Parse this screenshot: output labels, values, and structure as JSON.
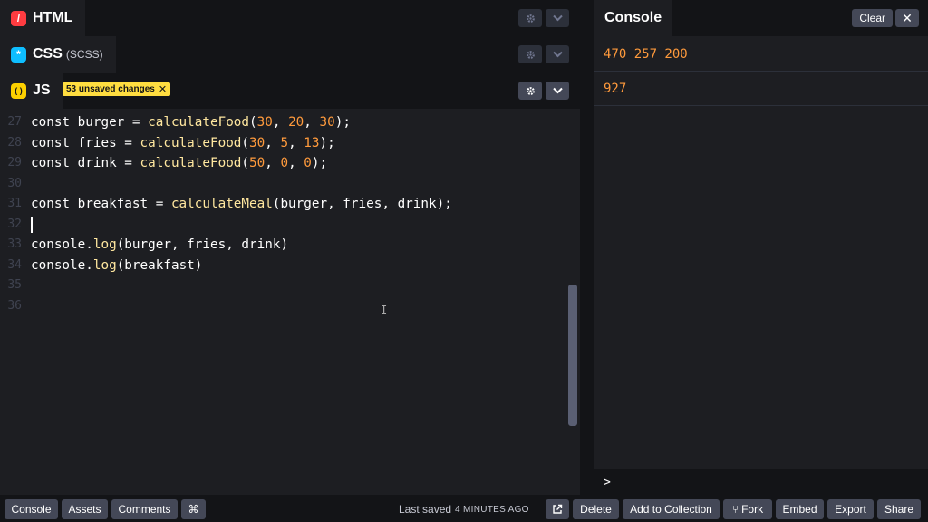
{
  "panels": {
    "html": {
      "label": "HTML",
      "icon": "/"
    },
    "css": {
      "label": "CSS",
      "sub": "(SCSS)",
      "icon": "*"
    },
    "js": {
      "label": "JS",
      "icon": "( )",
      "badge": "53 unsaved changes",
      "badge_close": "✕"
    }
  },
  "code": {
    "lines": [
      {
        "n": "27",
        "parts": [
          [
            "src",
            "const burger = "
          ],
          [
            "fn",
            "calculateFood"
          ],
          [
            "src",
            "("
          ],
          [
            "num",
            "30"
          ],
          [
            "src",
            ", "
          ],
          [
            "num",
            "20"
          ],
          [
            "src",
            ", "
          ],
          [
            "num",
            "30"
          ],
          [
            "src",
            ");"
          ]
        ]
      },
      {
        "n": "28",
        "parts": [
          [
            "src",
            "const fries = "
          ],
          [
            "fn",
            "calculateFood"
          ],
          [
            "src",
            "("
          ],
          [
            "num",
            "30"
          ],
          [
            "src",
            ", "
          ],
          [
            "num",
            "5"
          ],
          [
            "src",
            ", "
          ],
          [
            "num",
            "13"
          ],
          [
            "src",
            ");"
          ]
        ]
      },
      {
        "n": "29",
        "parts": [
          [
            "src",
            "const drink = "
          ],
          [
            "fn",
            "calculateFood"
          ],
          [
            "src",
            "("
          ],
          [
            "num",
            "50"
          ],
          [
            "src",
            ", "
          ],
          [
            "num",
            "0"
          ],
          [
            "src",
            ", "
          ],
          [
            "num",
            "0"
          ],
          [
            "src",
            ");"
          ]
        ]
      },
      {
        "n": "30",
        "parts": []
      },
      {
        "n": "31",
        "parts": [
          [
            "src",
            "const breakfast = "
          ],
          [
            "fn",
            "calculateMeal"
          ],
          [
            "src",
            "(burger, fries, drink);"
          ]
        ]
      },
      {
        "n": "32",
        "parts": [],
        "cursor": true
      },
      {
        "n": "33",
        "parts": [
          [
            "src",
            "console."
          ],
          [
            "fn",
            "log"
          ],
          [
            "src",
            "(burger, fries, drink)"
          ]
        ]
      },
      {
        "n": "34",
        "parts": [
          [
            "src",
            "console."
          ],
          [
            "fn",
            "log"
          ],
          [
            "src",
            "(breakfast)"
          ]
        ]
      },
      {
        "n": "35",
        "parts": []
      },
      {
        "n": "36",
        "parts": []
      }
    ]
  },
  "console": {
    "title": "Console",
    "clear_label": "Clear",
    "close_label": "✕",
    "logs": [
      "470 257 200",
      "927"
    ],
    "prompt": ">"
  },
  "footer": {
    "console": "Console",
    "assets": "Assets",
    "comments": "Comments",
    "shortcut": "⌘",
    "last_saved_label": "Last saved",
    "last_saved_when": "4 MINUTES AGO",
    "delete": "Delete",
    "add_to_collection": "Add to Collection",
    "fork": "Fork",
    "fork_icon": "⑂",
    "embed": "Embed",
    "export": "Export",
    "share": "Share"
  },
  "colors": {
    "html_icon": "#ff3c41",
    "css_icon": "#0ebeff",
    "js_icon": "#fcd000",
    "number": "#ff9a3c",
    "function": "#ffe79f"
  }
}
